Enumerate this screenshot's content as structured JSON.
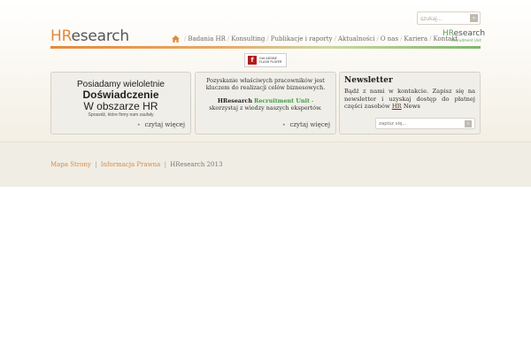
{
  "header": {
    "search_placeholder": "szukaj...",
    "search_button": "»",
    "logo_hr": "HR",
    "logo_rest": "esearch",
    "ru_logo": {
      "hr": "HR",
      "rest": "esearch",
      "sub": "Recruitment Unit"
    }
  },
  "nav": {
    "items": [
      "Badania HR",
      "Konsulting",
      "Publikacje i raporty",
      "Aktualności",
      "O nas",
      "Kariera",
      "Kontakt"
    ],
    "separator": "/"
  },
  "flash_badge": {
    "letter": "f",
    "line1": "Get ADOBE",
    "line2": "FLASH PLAYER"
  },
  "promo_box": {
    "line1": "Posiadamy wieloletnie",
    "line2": "Doświadczenie",
    "line3": "W obszarze HR",
    "line4": "Sprawdź, które firmy nam zaufały",
    "more_label": "czytaj więcej"
  },
  "center_box": {
    "text1": "Pozyskanie właściwych pracowników jest kluczem do realizacji celów biznesowych.",
    "brand": "HResearch",
    "brand_green": "Recruitment Unit",
    "text2": "- skorzystaj z wiedzy naszych ekspertów.",
    "more_label": "czytaj więcej"
  },
  "newsletter": {
    "title": "Newsletter",
    "body": "Bądź z nami w kontakcie. Zapisz się na newsletter i uzyskaj dostęp do płatnej części zasobów",
    "hr": "HR",
    "news": "News",
    "input_placeholder": "zapisz się...",
    "button": "»"
  },
  "footer": {
    "link1": "Mapa Strony",
    "link2": "Informacja Prawna",
    "copyright": "HResearch 2013",
    "separator": "|"
  },
  "colors": {
    "accent_orange": "#e38a3c",
    "accent_green": "#5aa05a",
    "footer_bg": "#f0ede4"
  }
}
